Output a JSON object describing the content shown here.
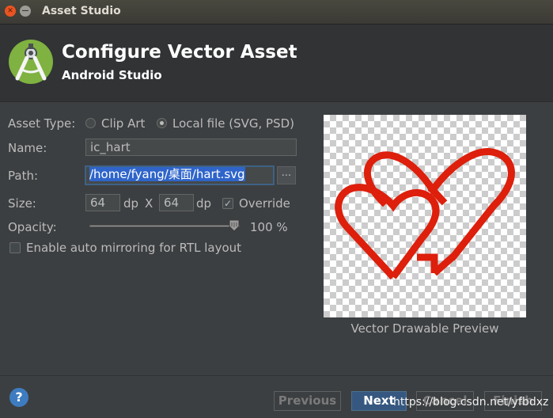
{
  "window": {
    "title": "Asset Studio"
  },
  "header": {
    "title": "Configure Vector Asset",
    "subtitle": "Android Studio"
  },
  "form": {
    "asset_type_label": "Asset Type:",
    "asset_type_options": [
      "Clip Art",
      "Local file (SVG, PSD)"
    ],
    "asset_type_selected": "Local file (SVG, PSD)",
    "name_label": "Name:",
    "name_value": "ic_hart",
    "path_label": "Path:",
    "path_value": "/home/fyang/桌面/hart.svg",
    "browse_label": "...",
    "size_label": "Size:",
    "width_value": "64",
    "height_value": "64",
    "unit_1": "dp",
    "unit_2": "dp",
    "times": "X",
    "override_label": "Override",
    "override_checked": true,
    "opacity_label": "Opacity:",
    "opacity_value": "100 %",
    "opacity_fraction": 1.0,
    "mirror_label": "Enable auto mirroring for RTL layout",
    "mirror_checked": false
  },
  "preview": {
    "caption": "Vector Drawable Preview",
    "icon_color": "#dd1f0c"
  },
  "footer": {
    "help_label": "?",
    "buttons": [
      "Previous",
      "Next",
      "Cancel",
      "Finish"
    ]
  },
  "watermark": "https://blog.csdn.net/yfbdxz",
  "colors": {
    "background": "#3c3f41",
    "header": "#313335",
    "selection": "#2f65ca",
    "primary_button": "#365880"
  }
}
